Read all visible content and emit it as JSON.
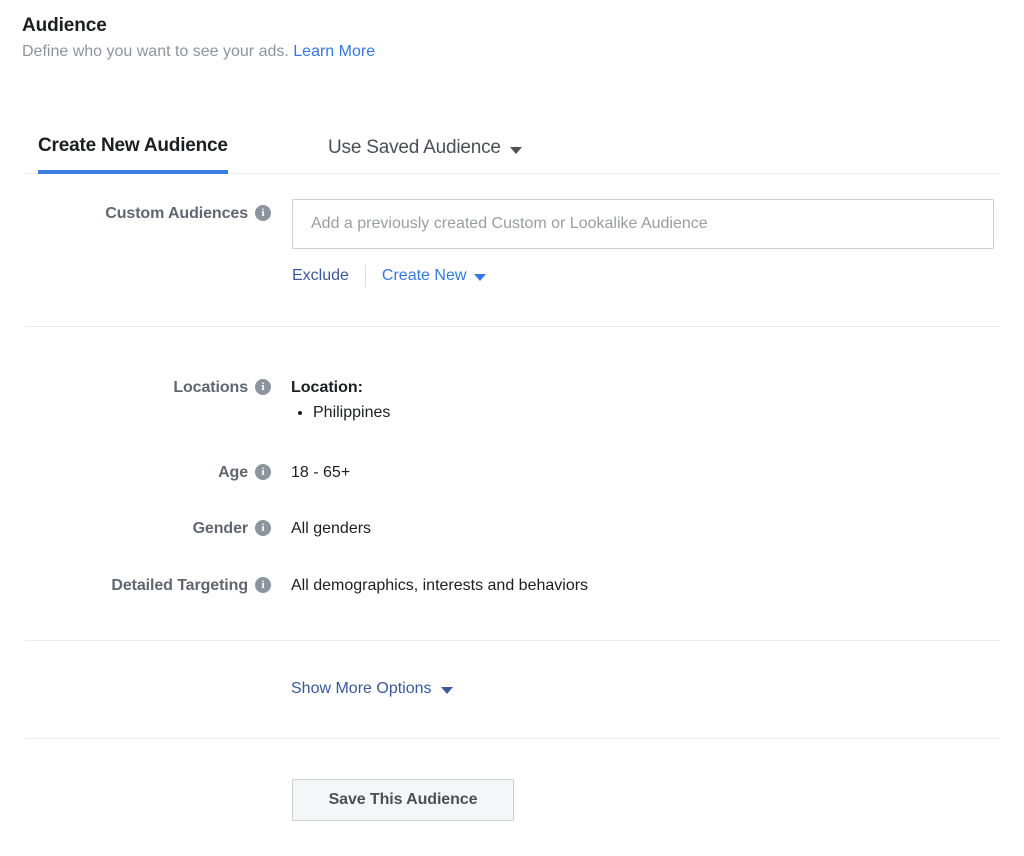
{
  "header": {
    "title": "Audience",
    "subtitle": "Define who you want to see your ads.",
    "learn_more": "Learn More"
  },
  "tabs": [
    {
      "label": "Create New Audience",
      "active": true
    },
    {
      "label": "Use Saved Audience",
      "active": false,
      "has_caret": true
    }
  ],
  "custom_audiences": {
    "label": "Custom Audiences",
    "info_glyph": "i",
    "placeholder": "Add a previously created Custom or Lookalike Audience",
    "value": "",
    "exclude_label": "Exclude",
    "create_new_label": "Create New"
  },
  "locations": {
    "label": "Locations",
    "heading": "Location:",
    "items": [
      "Philippines"
    ]
  },
  "age": {
    "label": "Age",
    "value": "18 - 65+"
  },
  "gender": {
    "label": "Gender",
    "value": "All genders"
  },
  "detailed_targeting": {
    "label": "Detailed Targeting",
    "value": "All demographics, interests and behaviors"
  },
  "show_more_options": {
    "label": "Show More Options"
  },
  "save_button": {
    "label": "Save This Audience"
  },
  "colors": {
    "link_blue": "#3578e5",
    "nav_blue": "#3b5998",
    "tab_underline": "#3b7ddd",
    "label_gray": "#606770",
    "muted_gray": "#8d949e",
    "divider": "#e9ebee",
    "button_bg": "#f5f6f7",
    "button_border": "#ccd0d5",
    "text": "#1c1e21",
    "background": "#ffffff"
  }
}
